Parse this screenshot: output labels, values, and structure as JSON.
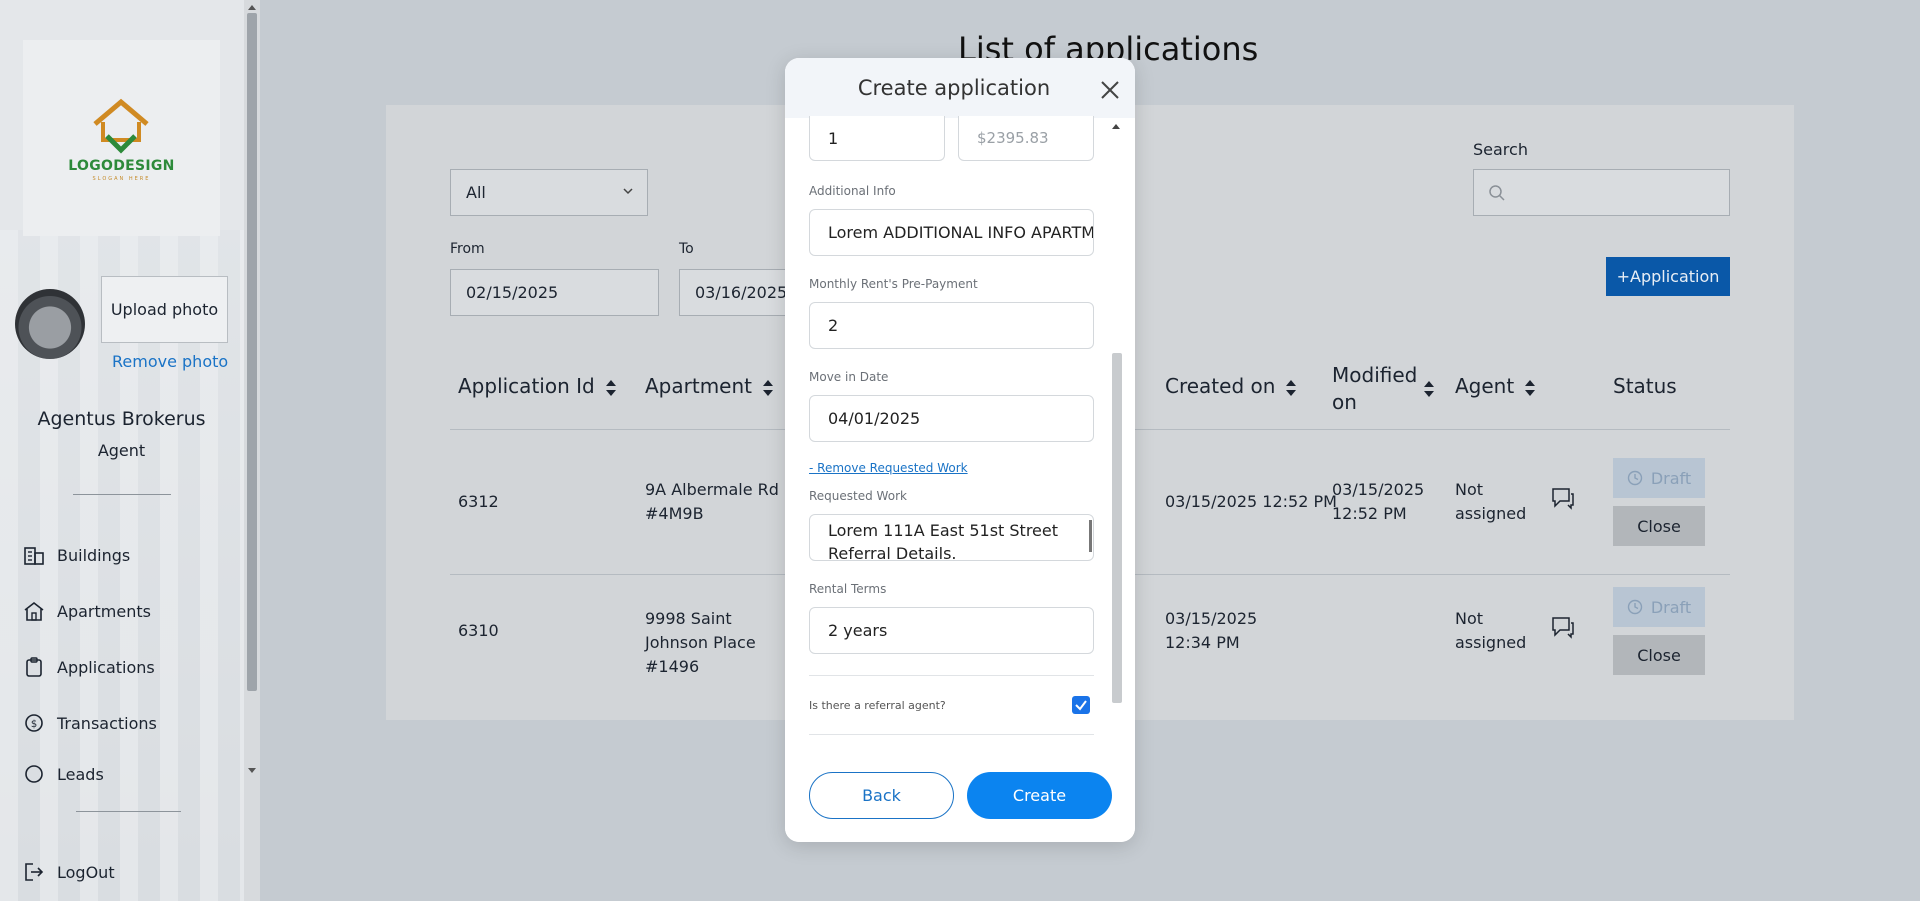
{
  "sidebar": {
    "logo_text": "LOGODESIGN",
    "logo_sub": "SLOGAN HERE",
    "upload_photo": "Upload photo",
    "remove_photo": "Remove photo",
    "user_name": "Agentus Brokerus",
    "user_role": "Agent",
    "items": [
      {
        "label": "Buildings",
        "icon": "buildings-icon"
      },
      {
        "label": "Apartments",
        "icon": "home-icon"
      },
      {
        "label": "Applications",
        "icon": "clipboard-icon"
      },
      {
        "label": "Transactions",
        "icon": "transactions-icon"
      },
      {
        "label": "Leads",
        "icon": "leads-icon"
      }
    ],
    "logout": "LogOut"
  },
  "main": {
    "title": "List of applications",
    "filter_value": "All",
    "from_label": "From",
    "from_value": "02/15/2025",
    "to_label": "To",
    "to_value": "03/16/2025",
    "search_label": "Search",
    "add_button": "+Application",
    "columns": {
      "app_id": "Application Id",
      "apartment": "Apartment",
      "created": "Created on",
      "modified": "Modified on",
      "agent": "Agent",
      "status": "Status"
    },
    "rows": [
      {
        "id": "6312",
        "apartment": "9A Albermale Rd #4M9B",
        "created": "03/15/2025 12:52 PM",
        "modified": "03/15/2025 12:52 PM",
        "agent": "Not assigned",
        "status": "Draft",
        "close": "Close"
      },
      {
        "id": "6310",
        "apartment": "9998 Saint Johnson Place #1496",
        "created": "03/15/2025 12:34 PM",
        "modified": "",
        "agent": "Not assigned",
        "status": "Draft",
        "close": "Close"
      }
    ]
  },
  "modal": {
    "title": "Create application",
    "top_left_value": "1",
    "top_right_placeholder": "$2395.83",
    "additional_info_label": "Additional Info",
    "additional_info_value": "Lorem ADDITIONAL INFO APARTMENT",
    "prepayment_label": "Monthly Rent's Pre-Payment",
    "prepayment_value": "2",
    "move_in_label": "Move in Date",
    "move_in_value": "04/01/2025",
    "remove_work_link": "- Remove Requested Work",
    "requested_work_label": "Requested Work",
    "requested_work_value": "Lorem 111A East 51st Street Referral Details.",
    "rental_terms_label": "Rental Terms",
    "rental_terms_value": "2 years",
    "referral_question": "Is there a referral agent?",
    "referral_checked": true,
    "back": "Back",
    "create": "Create"
  },
  "colors": {
    "accent": "#0b84f0",
    "link": "#1a73c6",
    "add_button": "#0a58a8"
  }
}
